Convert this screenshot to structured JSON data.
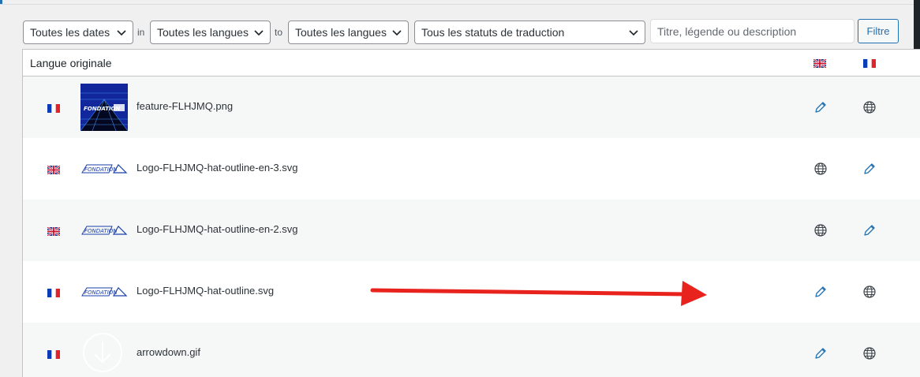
{
  "filters": {
    "dates": "Toutes les dates",
    "in_label": "in",
    "lang_from": "Toutes les langues",
    "to_label": "to",
    "lang_to": "Toutes les langues",
    "status": "Tous les statuts de traduction",
    "search_placeholder": "Titre, légende ou description",
    "filter_button": "Filtre"
  },
  "table": {
    "col_original": "Langue originale",
    "col_lang1": "en",
    "col_lang2": "fr",
    "rows": [
      {
        "lang": "fr",
        "name": "feature-FLHJMQ.png",
        "thumb": "fondation-logo-thumb",
        "en": "globe-icon",
        "fr_action": "pencil-icon",
        "en_action": "pencil-icon"
      },
      {
        "lang": "en",
        "name": "Logo-FLHJMQ-hat-outline-en-3.svg",
        "thumb": "logo-outline-thumb"
      },
      {
        "lang": "en",
        "name": "Logo-FLHJMQ-hat-outline-en-2.svg",
        "thumb": "logo-outline-thumb"
      },
      {
        "lang": "fr",
        "name": "Logo-FLHJMQ-hat-outline.svg",
        "thumb": "logo-outline-thumb"
      },
      {
        "lang": "fr",
        "name": "arrowdown.gif",
        "thumb": "arrow-down-thumb"
      }
    ]
  },
  "colors": {
    "accent": "#2271b1",
    "arrow": "#e8231e",
    "thumb_blue": "#1a3fa8"
  }
}
